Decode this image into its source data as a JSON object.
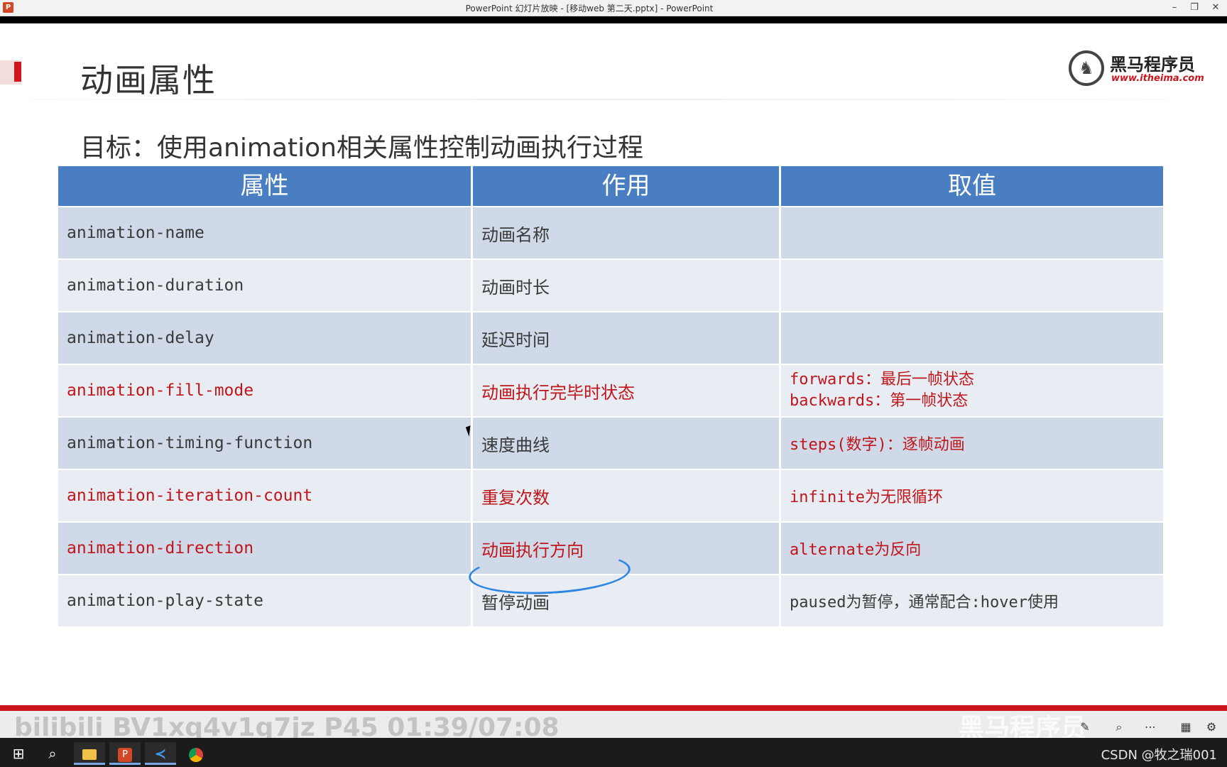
{
  "window": {
    "title": "PowerPoint 幻灯片放映 - [移动web 第二天.pptx] - PowerPoint",
    "app_icon": "powerpoint-icon",
    "controls": {
      "minimize": "–",
      "restore": "❐",
      "close": "✕"
    }
  },
  "slide": {
    "title": "动画属性",
    "logo": {
      "name": "黑马程序员",
      "url": "www.itheima.com"
    },
    "goal": "目标：使用animation相关属性控制动画执行过程",
    "table": {
      "headers": [
        "属性",
        "作用",
        "取值"
      ],
      "rows": [
        {
          "property": "animation-name",
          "purpose": "动画名称",
          "values": []
        },
        {
          "property": "animation-duration",
          "purpose": "动画时长",
          "values": []
        },
        {
          "property": "animation-delay",
          "purpose": "延迟时间",
          "values": []
        },
        {
          "property": "animation-fill-mode",
          "purpose": "动画执行完毕时状态",
          "values": [
            "forwards：最后一帧状态",
            "backwards：第一帧状态"
          ]
        },
        {
          "property": "animation-timing-function",
          "purpose": "速度曲线",
          "values": [
            "steps(数字)：逐帧动画"
          ]
        },
        {
          "property": "animation-iteration-count",
          "purpose": "重复次数",
          "values": [
            "infinite为无限循环"
          ]
        },
        {
          "property": "animation-direction",
          "purpose": "动画执行方向",
          "values": [
            "alternate为反向"
          ]
        },
        {
          "property": "animation-play-state",
          "purpose": "暂停动画",
          "values": [
            "paused为暂停，通常配合:hover使用"
          ]
        }
      ]
    }
  },
  "overlay": {
    "watermark": "bilibili  BV1xq4v1q7jz  P45  01:39/07:08",
    "brand_ghost": "黑马程序员"
  },
  "taskbar": {
    "icons": [
      "windows-start-icon",
      "search-icon",
      "file-explorer-icon",
      "powerpoint-icon",
      "vscode-icon",
      "chrome-icon"
    ],
    "right_text": "CSDN @牧之瑞001"
  },
  "colors": {
    "header_blue": "#4a7ec2",
    "accent_red": "#c0151a",
    "row_dark": "#cfd9e8",
    "row_light": "#e8edf4"
  }
}
